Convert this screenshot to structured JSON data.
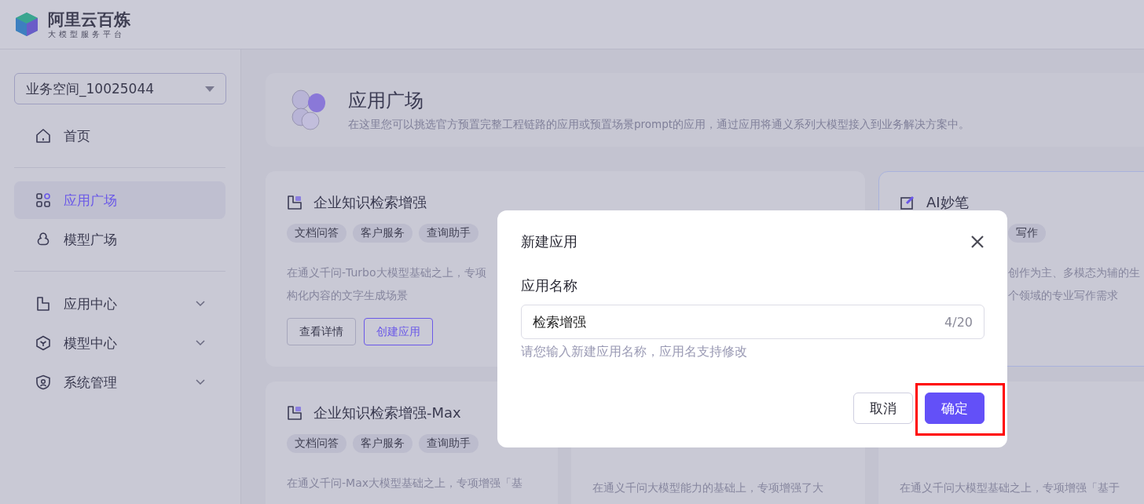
{
  "brand": {
    "name": "阿里云百炼",
    "subtitle": "大模型服务平台"
  },
  "sidebar": {
    "workspace": "业务空间_10025044",
    "sections": [
      [
        {
          "label": "首页",
          "selected": false,
          "expandable": false
        }
      ],
      [
        {
          "label": "应用广场",
          "selected": true,
          "expandable": false
        },
        {
          "label": "模型广场",
          "selected": false,
          "expandable": false
        }
      ],
      [
        {
          "label": "应用中心",
          "selected": false,
          "expandable": true
        },
        {
          "label": "模型中心",
          "selected": false,
          "expandable": true
        },
        {
          "label": "系统管理",
          "selected": false,
          "expandable": true
        }
      ]
    ]
  },
  "banner": {
    "title": "应用广场",
    "description": "在这里您可以挑选官方预置完整工程链路的应用或预置场景prompt的应用，通过应用将通义系列大模型接入到业务解决方案中。"
  },
  "cards": [
    {
      "kind": "full",
      "highlighted": false,
      "title": "企业知识检索增强",
      "tags": [
        "文档问答",
        "客户服务",
        "查询助手"
      ],
      "description_lines": [
        "在通义千问-Turbo大模型基础之上，专项",
        "构化内容的文字生成场景"
      ],
      "buttons": [
        {
          "label": "查看详情",
          "primary": false
        },
        {
          "label": "创建应用",
          "primary": true
        }
      ]
    },
    {
      "kind": "covered_left",
      "highlighted": true,
      "title": "AI妙笔",
      "tags": [
        "写作"
      ],
      "description_lines": [
        "创作为主、多模态为辅的生",
        "个领域的专业写作需求"
      ]
    },
    {
      "kind": "full",
      "highlighted": false,
      "title": "企业知识检索增强-Max",
      "tags": [
        "文档问答",
        "客户服务",
        "查询助手"
      ],
      "description_lines": [
        "在通义千问-Max大模型基础之上，专项增强「基"
      ]
    },
    {
      "kind": "covered_top",
      "highlighted": false,
      "description_lines": [
        "在通义千问大模型能力的基础上，专项增强了大"
      ]
    },
    {
      "kind": "covered_top",
      "highlighted": false,
      "description_lines": [
        "在通义千问大模型基础之上，专项增强「基于"
      ]
    }
  ],
  "dialog": {
    "title": "新建应用",
    "field_label": "应用名称",
    "value": "检索增强",
    "counter": "4/20",
    "hint": "请您输入新建应用名称，应用名支持修改",
    "buttons": [
      {
        "label": "取消",
        "primary": false
      },
      {
        "label": "确定",
        "primary": true
      }
    ]
  }
}
